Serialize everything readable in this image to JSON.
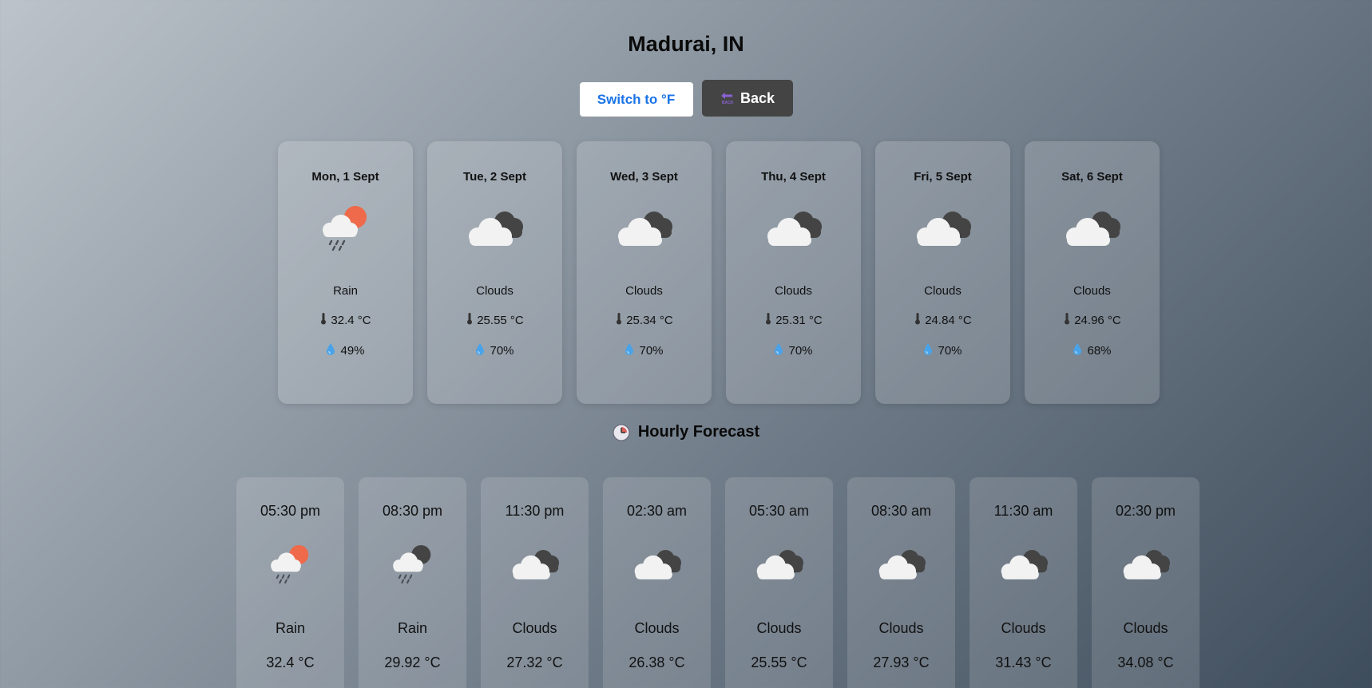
{
  "header": {
    "city": "Madurai, IN"
  },
  "controls": {
    "unit_toggle_label": "Switch to °F",
    "back_label": "Back"
  },
  "daily": [
    {
      "date": "Mon, 1 Sept",
      "icon": "rain-sun-icon",
      "condition": "Rain",
      "temp": "32.4 °C",
      "humidity": "49%"
    },
    {
      "date": "Tue, 2 Sept",
      "icon": "clouds-icon",
      "condition": "Clouds",
      "temp": "25.55 °C",
      "humidity": "70%"
    },
    {
      "date": "Wed, 3 Sept",
      "icon": "clouds-icon",
      "condition": "Clouds",
      "temp": "25.34 °C",
      "humidity": "70%"
    },
    {
      "date": "Thu, 4 Sept",
      "icon": "clouds-icon",
      "condition": "Clouds",
      "temp": "25.31 °C",
      "humidity": "70%"
    },
    {
      "date": "Fri, 5 Sept",
      "icon": "clouds-icon",
      "condition": "Clouds",
      "temp": "24.84 °C",
      "humidity": "70%"
    },
    {
      "date": "Sat, 6 Sept",
      "icon": "clouds-icon",
      "condition": "Clouds",
      "temp": "24.96 °C",
      "humidity": "68%"
    }
  ],
  "hourly_section": {
    "title": "Hourly Forecast"
  },
  "hourly": [
    {
      "time": "05:30 pm",
      "icon": "rain-sun-icon",
      "condition": "Rain",
      "temp": "32.4 °C"
    },
    {
      "time": "08:30 pm",
      "icon": "rain-moon-icon",
      "condition": "Rain",
      "temp": "29.92 °C"
    },
    {
      "time": "11:30 pm",
      "icon": "clouds-icon",
      "condition": "Clouds",
      "temp": "27.32 °C"
    },
    {
      "time": "02:30 am",
      "icon": "clouds-icon",
      "condition": "Clouds",
      "temp": "26.38 °C"
    },
    {
      "time": "05:30 am",
      "icon": "clouds-icon",
      "condition": "Clouds",
      "temp": "25.55 °C"
    },
    {
      "time": "08:30 am",
      "icon": "clouds-icon",
      "condition": "Clouds",
      "temp": "27.93 °C"
    },
    {
      "time": "11:30 am",
      "icon": "clouds-icon",
      "condition": "Clouds",
      "temp": "31.43 °C"
    },
    {
      "time": "02:30 pm",
      "icon": "clouds-icon",
      "condition": "Clouds",
      "temp": "34.08 °C"
    }
  ],
  "colors": {
    "unit_button_text": "#1a73e8",
    "back_button_bg": "#444444",
    "sun": "#ee6a4a",
    "cloud_light": "#f2f2f2",
    "cloud_dark": "#444444"
  }
}
